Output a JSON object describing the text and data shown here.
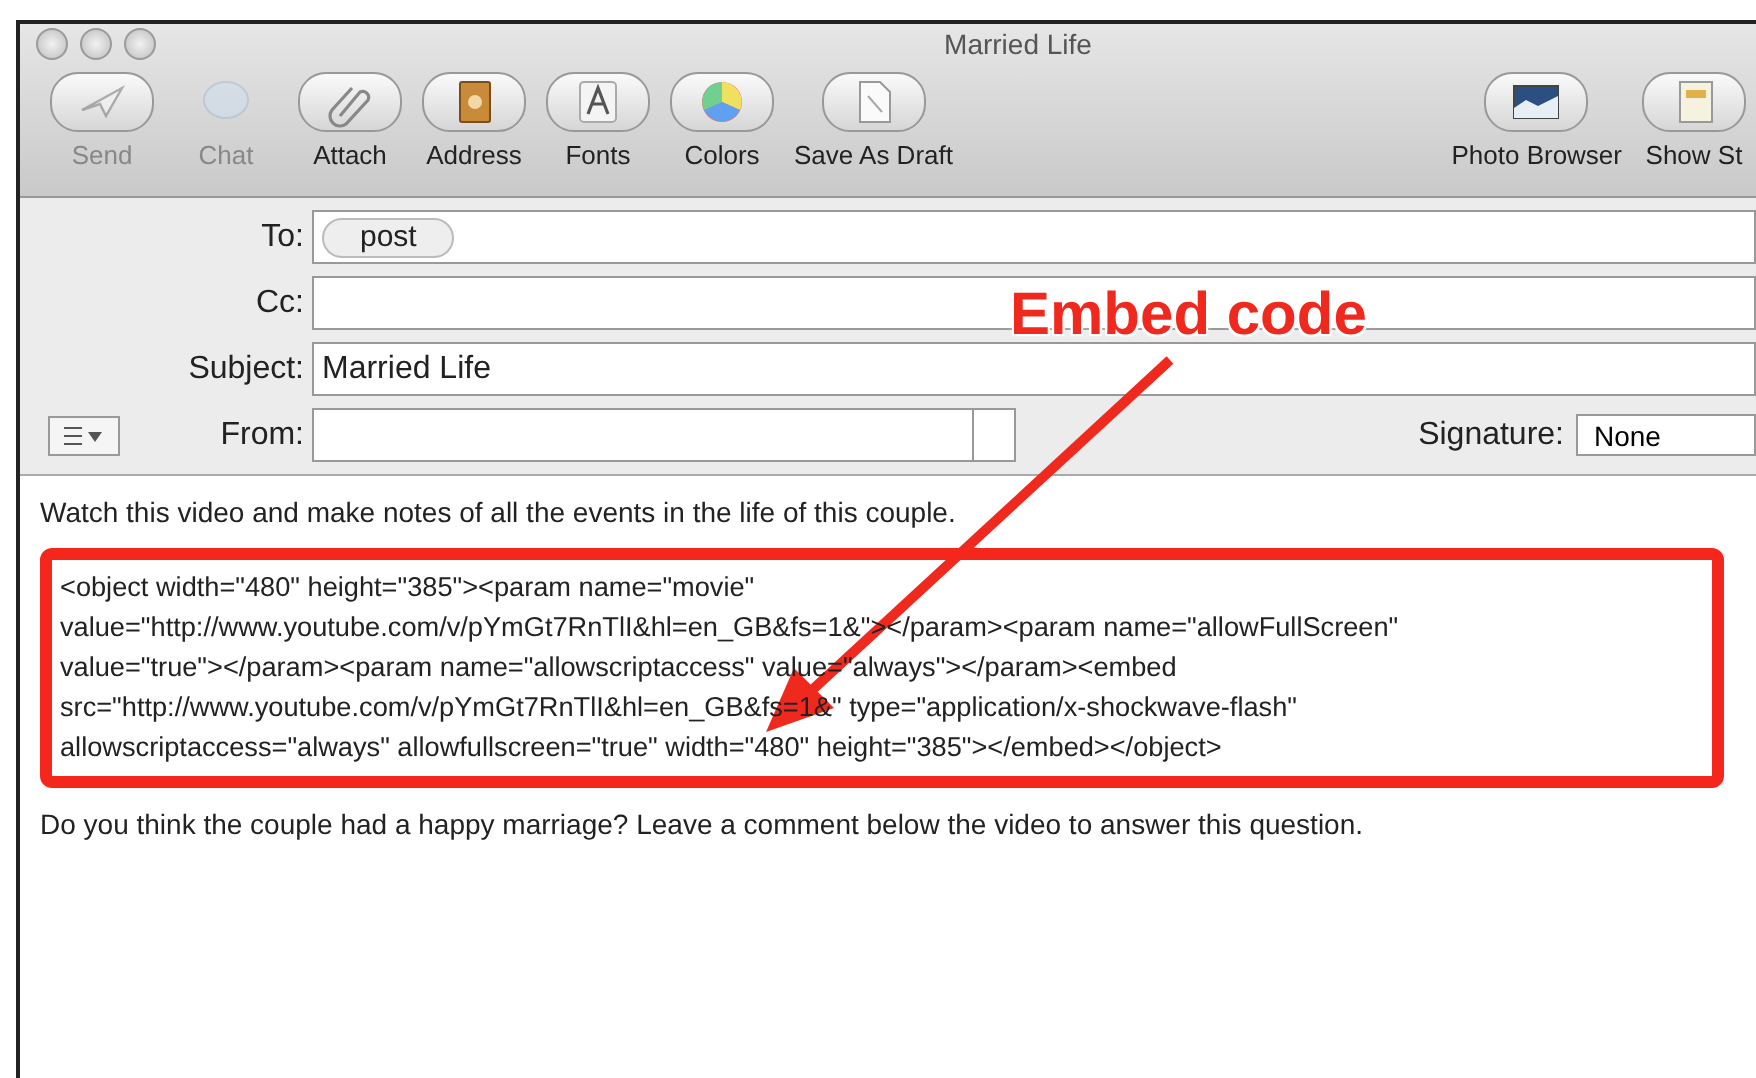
{
  "window": {
    "title": "Married Life"
  },
  "toolbar": {
    "left": [
      {
        "label": "Send",
        "kind": "send",
        "disabled": true
      },
      {
        "label": "Chat",
        "kind": "chat",
        "disabled": true
      },
      {
        "label": "Attach",
        "kind": "attach",
        "disabled": false
      },
      {
        "label": "Address",
        "kind": "address",
        "disabled": false
      },
      {
        "label": "Fonts",
        "kind": "fonts",
        "disabled": false
      },
      {
        "label": "Colors",
        "kind": "colors",
        "disabled": false
      },
      {
        "label": "Save As Draft",
        "kind": "draft",
        "disabled": false
      }
    ],
    "right": [
      {
        "label": "Photo Browser",
        "kind": "photo",
        "disabled": false
      },
      {
        "label": "Show St",
        "kind": "stationery",
        "disabled": false
      }
    ]
  },
  "header": {
    "to_label": "To:",
    "to_recipients": [
      "post"
    ],
    "cc_label": "Cc:",
    "subject_label": "Subject:",
    "subject": "Married Life",
    "from_label": "From:",
    "signature_label": "Signature:",
    "signature": "None"
  },
  "annotation": {
    "text": "Embed code"
  },
  "body": {
    "intro": "Watch this video and make notes of all the events in the life of this couple.",
    "code_lines": [
      "<object width=\"480\" height=\"385\"><param name=\"movie\"",
      "value=\"http://www.youtube.com/v/pYmGt7RnTlI&hl=en_GB&fs=1&\"></param><param name=\"allowFullScreen\"",
      "value=\"true\"></param><param name=\"allowscriptaccess\" value=\"always\"></param><embed",
      "src=\"http://www.youtube.com/v/pYmGt7RnTlI&hl=en_GB&fs=1&\" type=\"application/x-shockwave-flash\"",
      "allowscriptaccess=\"always\" allowfullscreen=\"true\" width=\"480\" height=\"385\"></embed></object>"
    ],
    "question": "Do you think the couple had a happy marriage? Leave a comment below the video to answer this question."
  }
}
